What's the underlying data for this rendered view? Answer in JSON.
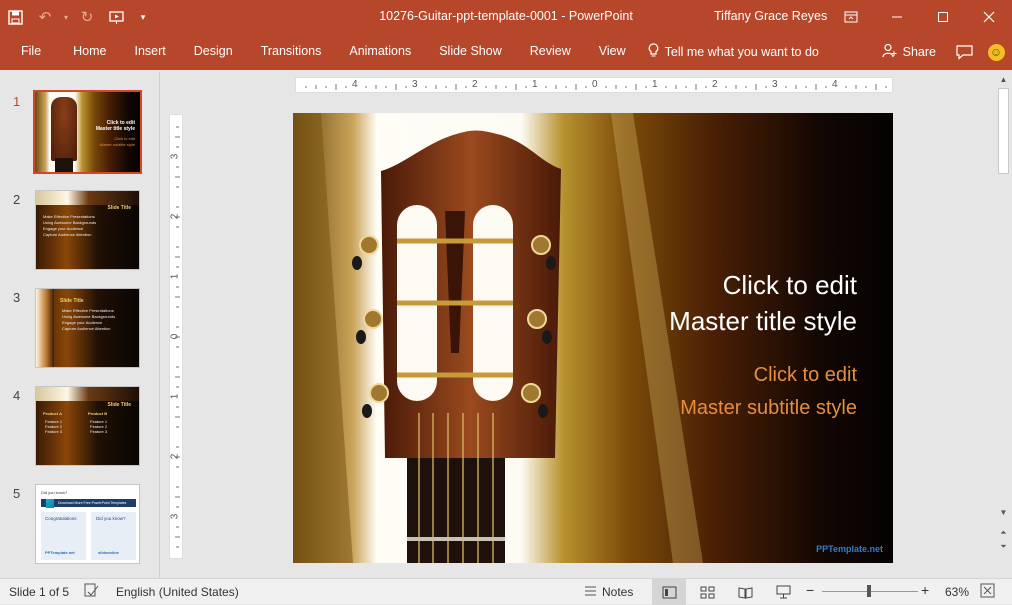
{
  "window": {
    "doc_title": "10276-Guitar-ppt-template-0001  -  PowerPoint",
    "user": "Tiffany Grace Reyes"
  },
  "ribbon": {
    "tabs": [
      "File",
      "Home",
      "Insert",
      "Design",
      "Transitions",
      "Animations",
      "Slide Show",
      "Review",
      "View"
    ],
    "tell_me": "Tell me what you want to do",
    "share": "Share"
  },
  "thumbnails": [
    {
      "num": "1",
      "title": "Click to edit\nMaster title style",
      "subtitle": "Click to edit\nMaster subtitle style"
    },
    {
      "num": "2",
      "title": "Slide Title",
      "bullets": [
        "Make Effective Presentations",
        "Using Awesome Backgrounds",
        "Engage your Audience",
        "Capture Audience Attention"
      ]
    },
    {
      "num": "3",
      "title": "Slide Title",
      "bullets": [
        "Make Effective Presentations",
        "Using Awesome Backgrounds",
        "Engage your Audience",
        "Capture Audience Attention"
      ]
    },
    {
      "num": "4",
      "title": "Slide Title",
      "col_headers": [
        "Product A",
        "Product B"
      ],
      "col_a": [
        "Feature 1",
        "Feature 2",
        "Feature 3"
      ],
      "col_b": [
        "Feature 1",
        "Feature 2",
        "Feature 3"
      ]
    },
    {
      "num": "5",
      "heading": "Did you know?",
      "banner": "Download More Free PowerPoint Templates",
      "box_a_title": "Congratulations",
      "box_b_title": "Did you know?",
      "logo_a": "PPTemplate.net",
      "logo_b": "slideonline"
    }
  ],
  "rulers": {
    "h_labels": [
      "4",
      "3",
      "2",
      "1",
      "0",
      "1",
      "2",
      "3",
      "4"
    ],
    "v_labels": [
      "3",
      "2",
      "1",
      "0",
      "1",
      "2",
      "3"
    ]
  },
  "slide": {
    "title_line1": "Click to edit",
    "title_line2": "Master title style",
    "subtitle_line1": "Click to edit",
    "subtitle_line2": "Master subtitle style",
    "footer_logo": "PPTemplate.net"
  },
  "status": {
    "slide_info": "Slide 1 of 5",
    "language": "English (United States)",
    "notes": "Notes",
    "zoom": "63%",
    "zoom_fraction": 0.63
  },
  "colors": {
    "accent": "#b7472a",
    "selection": "#d24726",
    "subtitle": "#e48e3f"
  }
}
